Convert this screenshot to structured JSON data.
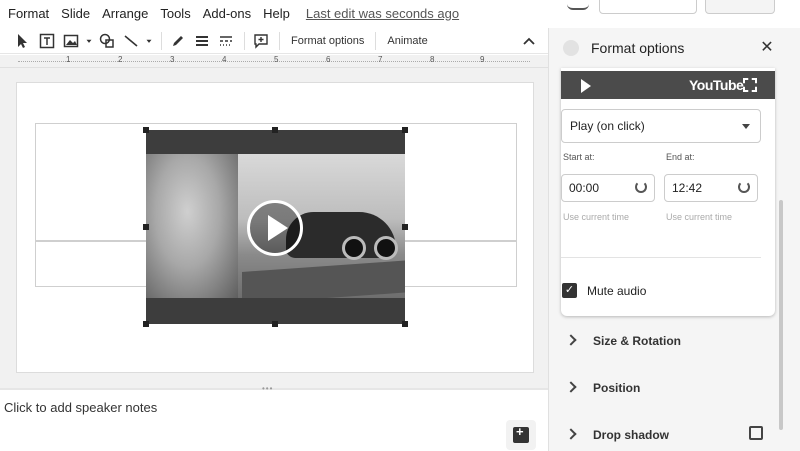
{
  "menu": {
    "items": [
      "Format",
      "Slide",
      "Arrange",
      "Tools",
      "Add-ons",
      "Help"
    ],
    "last_edit": "Last edit was seconds ago"
  },
  "toolbar": {
    "format_options_label": "Format options",
    "animate_label": "Animate"
  },
  "ruler": {
    "numbers": [
      "1",
      "2",
      "3",
      "4",
      "5",
      "6",
      "7",
      "8",
      "9"
    ]
  },
  "canvas": {
    "video": {
      "play_icon": "play-icon"
    }
  },
  "notes": {
    "placeholder": "Click to add speaker notes"
  },
  "panel": {
    "title": "Format options",
    "youtube_logo": "YouTube",
    "playback_select": "Play (on click)",
    "start_label": "Start at:",
    "end_label": "End at:",
    "start_value": "00:00",
    "end_value": "12:42",
    "use_current_time": "Use current time",
    "mute_label": "Mute audio",
    "mute_checked": true,
    "sections": [
      "Size & Rotation",
      "Position",
      "Drop shadow"
    ]
  }
}
